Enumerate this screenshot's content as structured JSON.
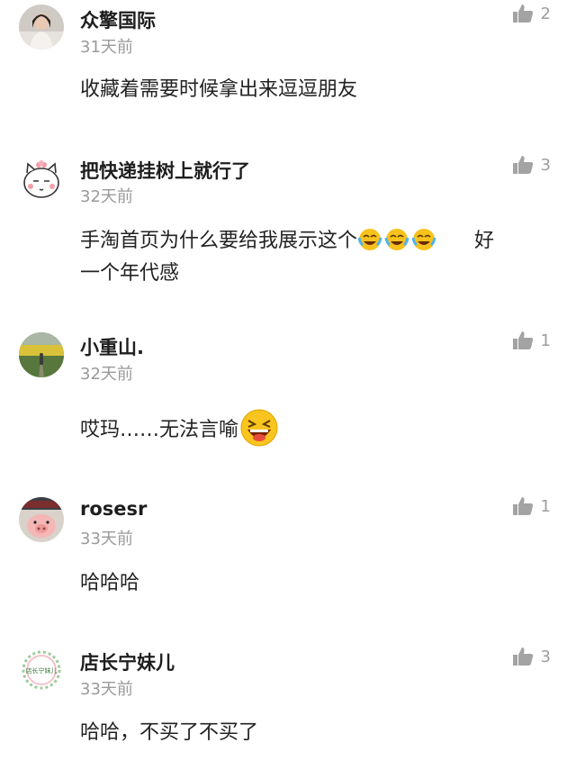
{
  "comments": [
    {
      "name": "众擎国际",
      "time": "31天前",
      "likes": "2",
      "text": "收藏着需要时候拿出来逗逗朋友",
      "avatar": "woman-photo-avatar"
    },
    {
      "name": "把快递挂树上就行了",
      "time": "32天前",
      "likes": "3",
      "text_before": "手淘首页为什么要给我展示这个",
      "emoji": "tears-of-joy-emoji",
      "text_after": "好",
      "text_line2": "一个年代感",
      "avatar": "cartoon-cat-avatar"
    },
    {
      "name": "小重山.",
      "time": "32天前",
      "likes": "1",
      "text": "哎玛……无法言喻",
      "emoji": "laughing-emoji",
      "avatar": "field-photo-avatar"
    },
    {
      "name": "rosesr",
      "time": "33天前",
      "likes": "1",
      "text": "哈哈哈",
      "avatar": "pig-photo-avatar"
    },
    {
      "name": "店长宁妹儿",
      "time": "33天前",
      "likes": "3",
      "text": "哈哈，不买了不买了",
      "avatar": "shop-logo-avatar",
      "avatar_text": "店长宁妹儿"
    }
  ],
  "colors": {
    "like_icon": "#9e9e9e",
    "time_text": "#9a9a9a"
  }
}
